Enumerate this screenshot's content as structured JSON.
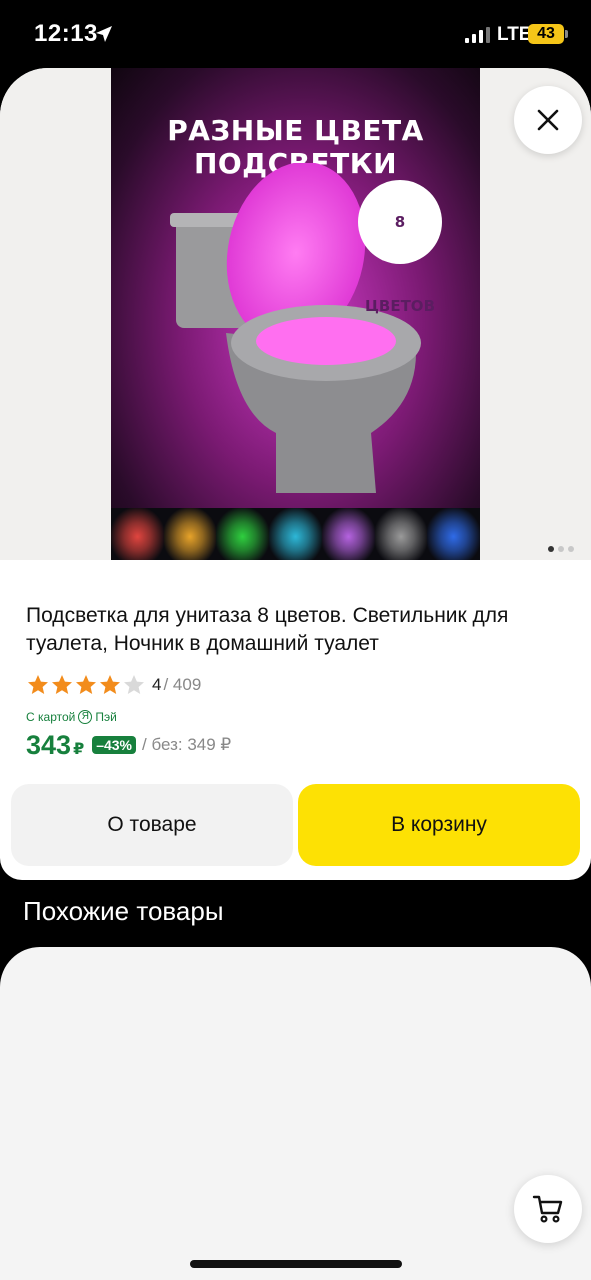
{
  "status_bar": {
    "time": "12:13",
    "network": "LTE",
    "battery": "43",
    "icons": [
      "location-arrow-icon",
      "signal-icon"
    ]
  },
  "product": {
    "image": {
      "headline": "РАЗНЫЕ ЦВЕТА ПОДСВЕТКИ",
      "badge": "8 ЦВЕТОВ",
      "swatch_colors": [
        "#e0453f",
        "#e7a32a",
        "#2fcf3f",
        "#2db8d8",
        "#b563e0",
        "#9a9a9a",
        "#2f6be8"
      ]
    },
    "gallery_pages": 3,
    "gallery_active_page": 1,
    "title": "Подсветка для унитаза 8 цветов. Светильник для туалета, Ночник в домашний туалет",
    "rating": {
      "stars": 4,
      "max_stars": 5,
      "value": "4",
      "reviews": "/ 409"
    },
    "pay": {
      "label": "С картой",
      "logo": "Я",
      "brand": "Пэй"
    },
    "price": {
      "current": "343",
      "currency": "₽",
      "discount": "–43%",
      "old_label": "/ без: 349 ₽"
    }
  },
  "actions": {
    "about_label": "О товаре",
    "cart_label": "В корзину"
  },
  "similar": {
    "title": "Похожие товары"
  },
  "colors": {
    "accent_yellow": "#fde104",
    "price_green": "#17803d",
    "star_orange": "#f28c1c"
  }
}
